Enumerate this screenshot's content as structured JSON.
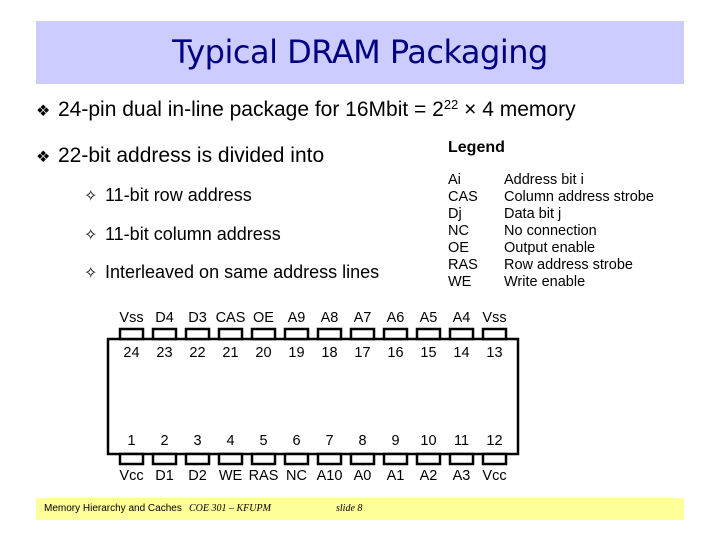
{
  "slide": {
    "title": "Typical DRAM Packaging",
    "bullets": [
      {
        "marker": "❖",
        "text_before": "24-pin dual in-line package for 16Mbit = 2",
        "sup": "22",
        "text_after": " × 4 memory"
      },
      {
        "marker": "❖",
        "text_before": "22-bit address is divided into",
        "sup": "",
        "text_after": ""
      }
    ],
    "sub_bullets": [
      {
        "marker": "✧",
        "text": "11-bit row address"
      },
      {
        "marker": "✧",
        "text": "11-bit column address"
      },
      {
        "marker": "✧",
        "text": "Interleaved on same address lines"
      }
    ],
    "legend": {
      "title": "Legend",
      "rows": [
        {
          "abbr": "Ai",
          "desc": "Address bit i"
        },
        {
          "abbr": "CAS",
          "desc": "Column address strobe"
        },
        {
          "abbr": "Dj",
          "desc": "Data bit j"
        },
        {
          "abbr": "NC",
          "desc": "No connection"
        },
        {
          "abbr": "OE",
          "desc": "Output enable"
        },
        {
          "abbr": "RAS",
          "desc": "Row address strobe"
        },
        {
          "abbr": "WE",
          "desc": "Write enable"
        }
      ]
    },
    "chip": {
      "top_pins": [
        {
          "name": "Vss",
          "num": "24"
        },
        {
          "name": "D4",
          "num": "23"
        },
        {
          "name": "D3",
          "num": "22"
        },
        {
          "name": "CAS",
          "num": "21"
        },
        {
          "name": "OE",
          "num": "20"
        },
        {
          "name": "A9",
          "num": "19"
        },
        {
          "name": "A8",
          "num": "18"
        },
        {
          "name": "A7",
          "num": "17"
        },
        {
          "name": "A6",
          "num": "16"
        },
        {
          "name": "A5",
          "num": "15"
        },
        {
          "name": "A4",
          "num": "14"
        },
        {
          "name": "Vss",
          "num": "13"
        }
      ],
      "bottom_pins": [
        {
          "name": "Vcc",
          "num": "1"
        },
        {
          "name": "D1",
          "num": "2"
        },
        {
          "name": "D2",
          "num": "3"
        },
        {
          "name": "WE",
          "num": "4"
        },
        {
          "name": "RAS",
          "num": "5"
        },
        {
          "name": "NC",
          "num": "6"
        },
        {
          "name": "A10",
          "num": "7"
        },
        {
          "name": "A0",
          "num": "8"
        },
        {
          "name": "A1",
          "num": "9"
        },
        {
          "name": "A2",
          "num": "10"
        },
        {
          "name": "A3",
          "num": "11"
        },
        {
          "name": "Vcc",
          "num": "12"
        }
      ]
    },
    "footer": {
      "topic": "Memory Hierarchy and Caches",
      "course": "COE 301 – KFUPM",
      "slide": "slide 8"
    },
    "colors": {
      "title_bg": "#ccccff",
      "title_text": "#000080",
      "footer_bg": "#ffff99"
    }
  }
}
